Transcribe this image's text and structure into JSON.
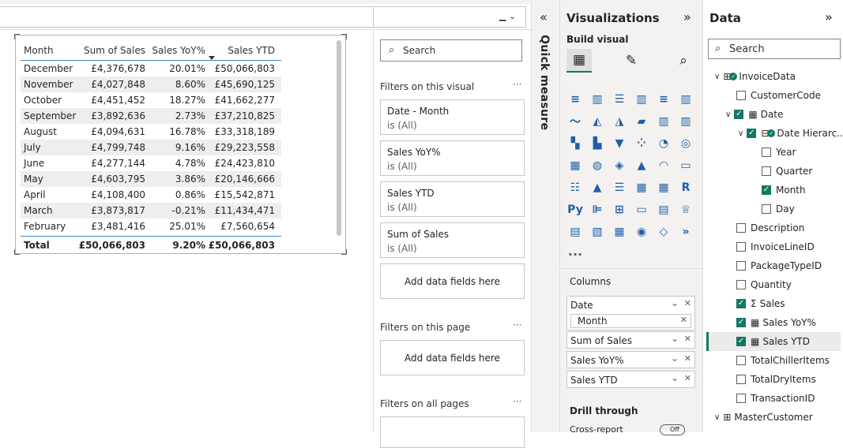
{
  "table": {
    "headers": [
      "Month",
      "Sum of Sales",
      "Sales YoY%",
      "Sales YTD"
    ],
    "rows": [
      [
        "December",
        "£4,376,678",
        "20.01%",
        "£50,066,803"
      ],
      [
        "November",
        "£4,027,848",
        "8.60%",
        "£45,690,125"
      ],
      [
        "October",
        "£4,451,452",
        "18.27%",
        "£41,662,277"
      ],
      [
        "September",
        "£3,892,636",
        "2.73%",
        "£37,210,825"
      ],
      [
        "August",
        "£4,094,631",
        "16.78%",
        "£33,318,189"
      ],
      [
        "July",
        "£4,799,748",
        "9.16%",
        "£29,223,558"
      ],
      [
        "June",
        "£4,277,144",
        "4.78%",
        "£24,423,810"
      ],
      [
        "May",
        "£4,603,795",
        "3.86%",
        "£20,146,666"
      ],
      [
        "April",
        "£4,108,400",
        "0.86%",
        "£15,542,871"
      ],
      [
        "March",
        "£3,873,817",
        "-0.21%",
        "£11,434,471"
      ],
      [
        "February",
        "£3,481,416",
        "25.01%",
        "£7,560,654"
      ]
    ],
    "total": [
      "Total",
      "£50,066,803",
      "9.20%",
      "£50,066,803"
    ]
  },
  "filters": {
    "search_placeholder": "Search",
    "on_visual_label": "Filters on this visual",
    "more": "···",
    "cards": [
      {
        "title": "Date - Month",
        "value": "is (All)"
      },
      {
        "title": "Sales YoY%",
        "value": "is (All)"
      },
      {
        "title": "Sales YTD",
        "value": "is (All)"
      },
      {
        "title": "Sum of Sales",
        "value": "is (All)"
      }
    ],
    "add_fields": "Add data fields here",
    "on_page_label": "Filters on this page",
    "on_all_label": "Filters on all pages"
  },
  "quick_measure": {
    "label": "Quick measure",
    "chevron": "«"
  },
  "visualizations": {
    "title": "Visualizations",
    "chevron": "»",
    "build_visual": "Build visual",
    "columns_label": "Columns",
    "wells": {
      "date": "Date",
      "month": "Month",
      "sum_sales": "Sum of Sales",
      "yoy": "Sales YoY%",
      "ytd": "Sales YTD"
    },
    "drill_through": "Drill through",
    "cross_report": "Cross-report",
    "toggle": "Off"
  },
  "data_pane": {
    "title": "Data",
    "chevron": "»",
    "search_placeholder": "Search",
    "fields": [
      {
        "label": "InvoiceData",
        "checked": false
      },
      {
        "label": "CustomerCode",
        "checked": false
      },
      {
        "label": "Date",
        "checked": true
      },
      {
        "label": "Date Hierarc...",
        "checked": true
      },
      {
        "label": "Year",
        "checked": false
      },
      {
        "label": "Quarter",
        "checked": false
      },
      {
        "label": "Month",
        "checked": true
      },
      {
        "label": "Day",
        "checked": false
      },
      {
        "label": "Description",
        "checked": false
      },
      {
        "label": "InvoiceLineID",
        "checked": false
      },
      {
        "label": "PackageTypeID",
        "checked": false
      },
      {
        "label": "Quantity",
        "checked": false
      },
      {
        "label": "Sales",
        "checked": true
      },
      {
        "label": "Sales YoY%",
        "checked": true
      },
      {
        "label": "Sales YTD",
        "checked": true
      },
      {
        "label": "TotalChillerItems",
        "checked": false
      },
      {
        "label": "TotalDryItems",
        "checked": false
      },
      {
        "label": "TransactionID",
        "checked": false
      },
      {
        "label": "MasterCustomer",
        "checked": false
      }
    ]
  },
  "colors": {
    "accent": "#117865",
    "table_rule": "#3a87c8",
    "pane_bg": "#f3f2f1"
  }
}
